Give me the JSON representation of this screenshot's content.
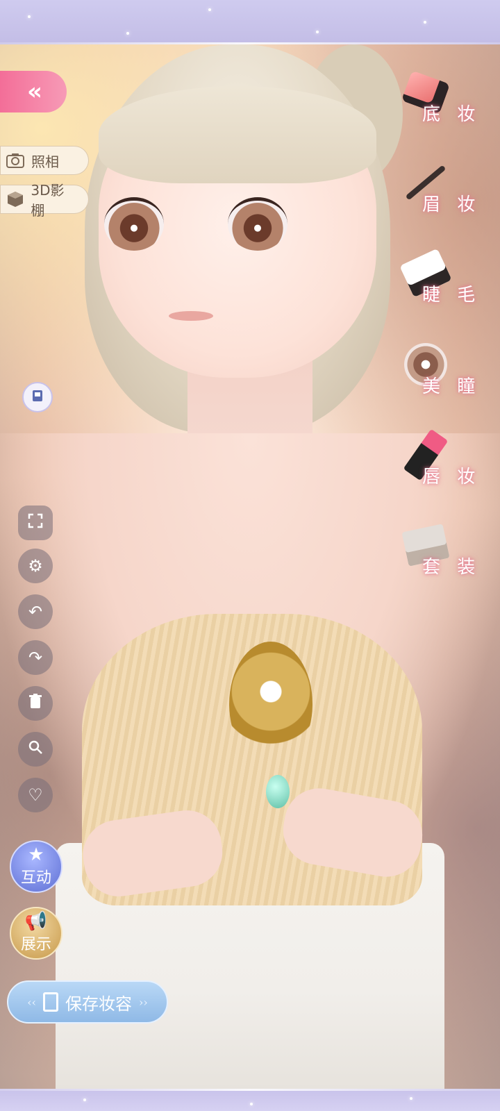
{
  "left_panel": {
    "back_button": {
      "label": "«"
    },
    "photo_button": {
      "label": "照相",
      "icon": "camera-icon"
    },
    "studio_button": {
      "label": "3D影棚",
      "icon": "cube-icon"
    },
    "wardrobe_toggle": {
      "icon": "outfit-icon"
    },
    "tools": [
      {
        "name": "fullscreen",
        "icon": "expand-icon"
      },
      {
        "name": "settings",
        "icon": "gear-icon"
      },
      {
        "name": "undo",
        "icon": "undo-icon"
      },
      {
        "name": "redo",
        "icon": "redo-icon"
      },
      {
        "name": "delete",
        "icon": "trash-icon"
      },
      {
        "name": "search",
        "icon": "search-icon"
      },
      {
        "name": "favorite",
        "icon": "heart-icon"
      }
    ],
    "interact_button": {
      "label": "互动",
      "icon": "star-icon"
    },
    "show_button": {
      "label": "展示",
      "icon": "megaphone-icon"
    },
    "save_button": {
      "label": "保存妆容"
    }
  },
  "makeup_menu": [
    {
      "label": "底 妆",
      "icon": "foundation-brush-icon"
    },
    {
      "label": "眉 妆",
      "icon": "eyebrow-pencil-icon"
    },
    {
      "label": "睫 毛",
      "icon": "eyelash-icon"
    },
    {
      "label": "美 瞳",
      "icon": "contact-lens-icon"
    },
    {
      "label": "唇 妆",
      "icon": "lipstick-icon"
    },
    {
      "label": "套 装",
      "icon": "makeup-palette-icon"
    }
  ],
  "colors": {
    "accent_pink": "#f36e98",
    "frame_lavender": "#c3bde6",
    "save_blue": "#8fb9e6"
  }
}
